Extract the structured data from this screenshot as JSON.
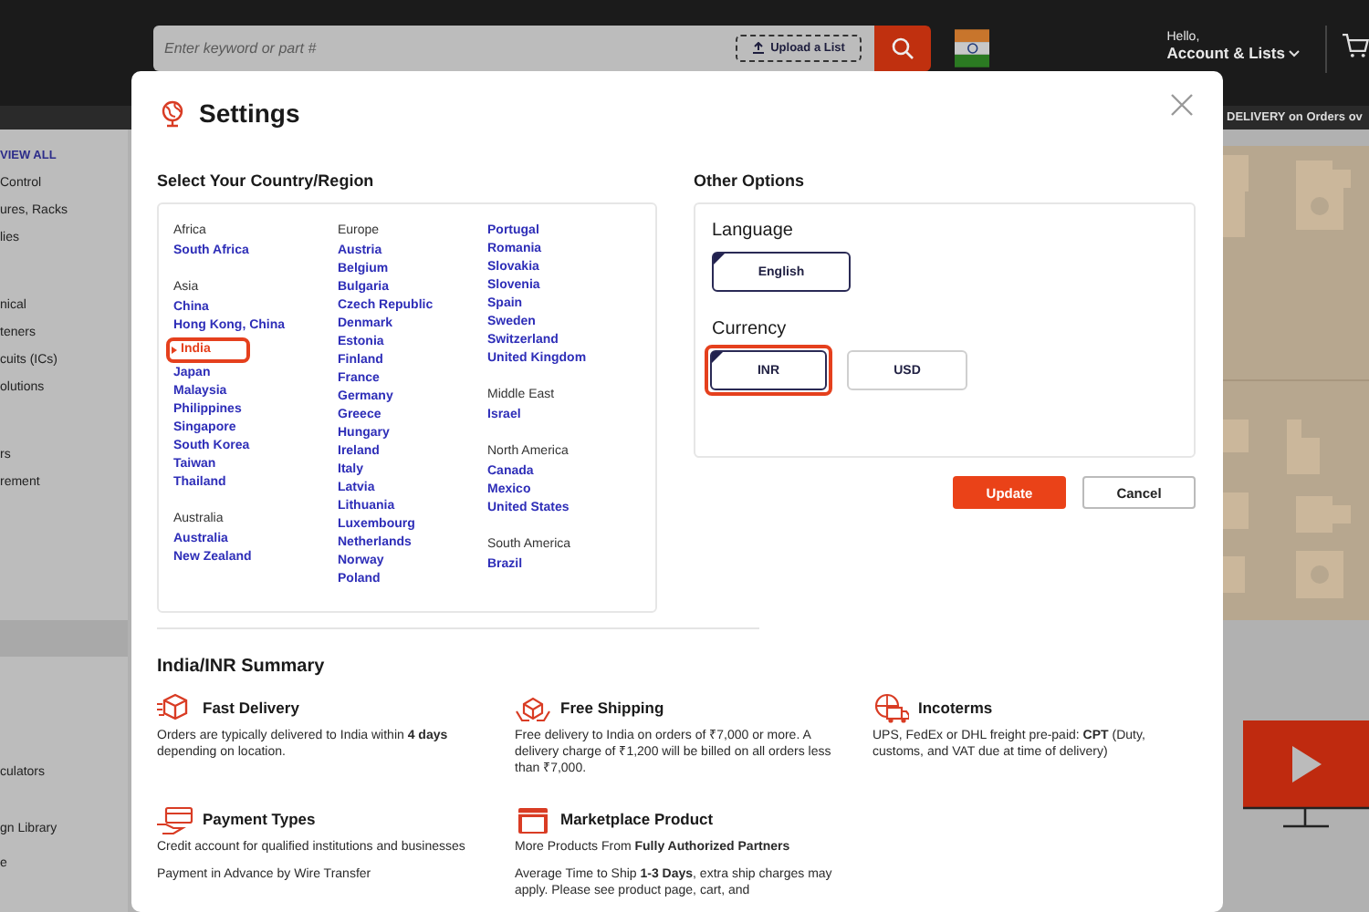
{
  "header": {
    "search": {
      "placeholder": "Enter keyword or part #"
    },
    "upload_button": "Upload a List",
    "greeting": "Hello,",
    "account_menu": "Account & Lists"
  },
  "promo_strip": "DELIVERY on Orders ov",
  "sidebar": {
    "groups": [
      {
        "items": [
          {
            "label": "VIEW ALL",
            "kind": "link"
          },
          {
            "label": "Control",
            "kind": "category"
          },
          {
            "label": "ures, Racks",
            "kind": "category"
          },
          {
            "label": "lies",
            "kind": "category"
          }
        ]
      },
      {
        "items": [
          {
            "label": "nical",
            "kind": "category"
          },
          {
            "label": "teners",
            "kind": "category"
          },
          {
            "label": "cuits (ICs)",
            "kind": "category"
          },
          {
            "label": "olutions",
            "kind": "category"
          }
        ]
      },
      {
        "items": [
          {
            "label": "rs",
            "kind": "category"
          },
          {
            "label": "rement",
            "kind": "category"
          }
        ]
      }
    ]
  },
  "lower_sidebar": {
    "groups": [
      {
        "items": [
          {
            "label": "culators",
            "kind": "category"
          }
        ]
      },
      {
        "items": [
          {
            "label": "gn Library",
            "kind": "category"
          },
          {
            "label": "e",
            "kind": "category"
          }
        ]
      }
    ]
  },
  "dialog": {
    "title": "Settings",
    "country_section": {
      "title": "Select Your Country/Region",
      "columns": [
        [
          {
            "region": "Africa",
            "countries": [
              {
                "name": "South Africa",
                "selected": false,
                "highlighted": false
              }
            ]
          },
          {
            "region": "Asia",
            "countries": [
              {
                "name": "China",
                "selected": false,
                "highlighted": false
              },
              {
                "name": "Hong Kong, China",
                "selected": false,
                "highlighted": false
              },
              {
                "name": "India",
                "selected": true,
                "highlighted": true
              },
              {
                "name": "Japan",
                "selected": false,
                "highlighted": false
              },
              {
                "name": "Malaysia",
                "selected": false,
                "highlighted": false
              },
              {
                "name": "Philippines",
                "selected": false,
                "highlighted": false
              },
              {
                "name": "Singapore",
                "selected": false,
                "highlighted": false
              },
              {
                "name": "South Korea",
                "selected": false,
                "highlighted": false
              },
              {
                "name": "Taiwan",
                "selected": false,
                "highlighted": false
              },
              {
                "name": "Thailand",
                "selected": false,
                "highlighted": false
              }
            ]
          },
          {
            "region": "Australia",
            "countries": [
              {
                "name": "Australia",
                "selected": false,
                "highlighted": false
              },
              {
                "name": "New Zealand",
                "selected": false,
                "highlighted": false
              }
            ]
          }
        ],
        [
          {
            "region": "Europe",
            "countries": [
              {
                "name": "Austria",
                "selected": false,
                "highlighted": false
              },
              {
                "name": "Belgium",
                "selected": false,
                "highlighted": false
              },
              {
                "name": "Bulgaria",
                "selected": false,
                "highlighted": false
              },
              {
                "name": "Czech Republic",
                "selected": false,
                "highlighted": false
              },
              {
                "name": "Denmark",
                "selected": false,
                "highlighted": false
              },
              {
                "name": "Estonia",
                "selected": false,
                "highlighted": false
              },
              {
                "name": "Finland",
                "selected": false,
                "highlighted": false
              },
              {
                "name": "France",
                "selected": false,
                "highlighted": false
              },
              {
                "name": "Germany",
                "selected": false,
                "highlighted": false
              },
              {
                "name": "Greece",
                "selected": false,
                "highlighted": false
              },
              {
                "name": "Hungary",
                "selected": false,
                "highlighted": false
              },
              {
                "name": "Ireland",
                "selected": false,
                "highlighted": false
              },
              {
                "name": "Italy",
                "selected": false,
                "highlighted": false
              },
              {
                "name": "Latvia",
                "selected": false,
                "highlighted": false
              },
              {
                "name": "Lithuania",
                "selected": false,
                "highlighted": false
              },
              {
                "name": "Luxembourg",
                "selected": false,
                "highlighted": false
              },
              {
                "name": "Netherlands",
                "selected": false,
                "highlighted": false
              },
              {
                "name": "Norway",
                "selected": false,
                "highlighted": false
              },
              {
                "name": "Poland",
                "selected": false,
                "highlighted": false
              }
            ]
          }
        ],
        [
          {
            "countries": [
              {
                "name": "Portugal",
                "selected": false,
                "highlighted": false
              },
              {
                "name": "Romania",
                "selected": false,
                "highlighted": false
              },
              {
                "name": "Slovakia",
                "selected": false,
                "highlighted": false
              },
              {
                "name": "Slovenia",
                "selected": false,
                "highlighted": false
              },
              {
                "name": "Spain",
                "selected": false,
                "highlighted": false
              },
              {
                "name": "Sweden",
                "selected": false,
                "highlighted": false
              },
              {
                "name": "Switzerland",
                "selected": false,
                "highlighted": false
              },
              {
                "name": "United Kingdom",
                "selected": false,
                "highlighted": false
              }
            ]
          },
          {
            "region": "Middle East",
            "countries": [
              {
                "name": "Israel",
                "selected": false,
                "highlighted": false
              }
            ]
          },
          {
            "region": "North America",
            "countries": [
              {
                "name": "Canada",
                "selected": false,
                "highlighted": false
              },
              {
                "name": "Mexico",
                "selected": false,
                "highlighted": false
              },
              {
                "name": "United States",
                "selected": false,
                "highlighted": false
              }
            ]
          },
          {
            "region": "South America",
            "countries": [
              {
                "name": "Brazil",
                "selected": false,
                "highlighted": false
              }
            ]
          }
        ]
      ]
    },
    "options_section": {
      "title": "Other Options",
      "language": {
        "label": "Language",
        "options": [
          {
            "label": "English",
            "selected": true,
            "highlighted": false
          }
        ]
      },
      "currency": {
        "label": "Currency",
        "options": [
          {
            "label": "INR",
            "selected": true,
            "highlighted": true
          },
          {
            "label": "USD",
            "selected": false,
            "highlighted": false
          }
        ]
      },
      "buttons": [
        {
          "label": "Update",
          "kind": "primary"
        },
        {
          "label": "Cancel",
          "kind": "secondary"
        }
      ]
    },
    "summary": {
      "title": "India/INR Summary",
      "items": [
        {
          "title": "Fast Delivery",
          "paragraphs": [
            "Orders are typically delivered to India within **4 days** depending on location."
          ]
        },
        {
          "title": "Free Shipping",
          "paragraphs": [
            "Free delivery to India on orders of ₹7,000 or more. A delivery charge of ₹1,200 will be billed on all orders less than ₹7,000."
          ]
        },
        {
          "title": "Incoterms",
          "paragraphs": [
            "UPS, FedEx or DHL freight pre-paid: **CPT** (Duty, customs, and VAT due at time of delivery)"
          ]
        },
        {
          "title": "Payment Types",
          "paragraphs": [
            "Credit account for qualified institutions and businesses",
            "Payment in Advance by Wire Transfer"
          ]
        },
        {
          "title": "Marketplace Product",
          "paragraphs": [
            "More Products From **Fully Authorized Partners**",
            "Average Time to Ship **1-3 Days**, extra ship charges may apply. Please see product page, cart, and"
          ]
        }
      ]
    }
  }
}
